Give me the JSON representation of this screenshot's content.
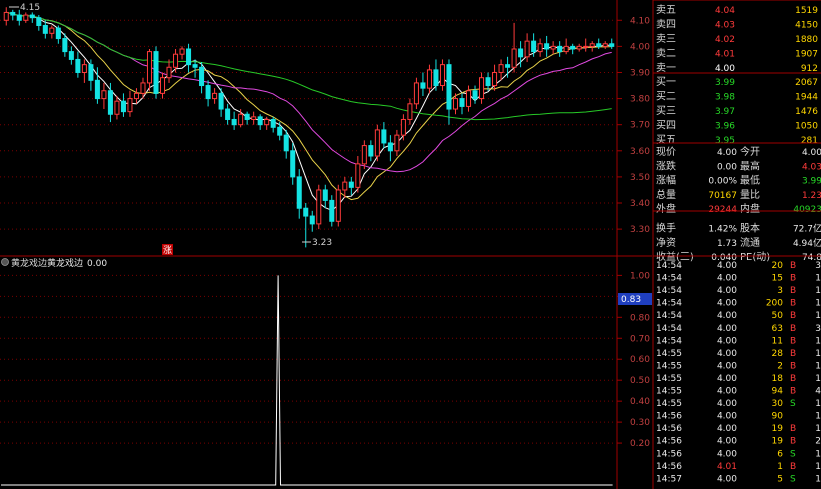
{
  "colors": {
    "up": "#ff3b3b",
    "down": "#14e3e3",
    "ma5": "#ffffff",
    "ma10": "#e8d24a",
    "ma20": "#e04ae0",
    "ma60": "#27c927",
    "grid": "#7a0000",
    "border": "#a00000",
    "highlight": "#1f3fbf",
    "sell_red": "#ff3b3b",
    "buy_green": "#27d827",
    "panel_label": "#d8d8d8",
    "yellow": "#ffd700"
  },
  "main_chart": {
    "max_label": "4.15",
    "min_label": "3.23",
    "y_ticks": [
      "4.10",
      "4.00",
      "3.90",
      "3.80",
      "3.70",
      "3.60",
      "3.50",
      "3.40",
      "3.30"
    ],
    "marker": "涨"
  },
  "chart_data": {
    "type": "candlestick",
    "y_range": [
      3.22,
      4.17
    ],
    "candles": [
      [
        4.1,
        4.13,
        4.08,
        4.15
      ],
      [
        4.13,
        4.12,
        4.1,
        4.14
      ],
      [
        4.12,
        4.1,
        4.08,
        4.14
      ],
      [
        4.1,
        4.12,
        4.09,
        4.13
      ],
      [
        4.12,
        4.11,
        4.09,
        4.13
      ],
      [
        4.11,
        4.08,
        4.06,
        4.12
      ],
      [
        4.08,
        4.05,
        4.03,
        4.1
      ],
      [
        4.05,
        4.07,
        4.03,
        4.08
      ],
      [
        4.07,
        4.03,
        4.01,
        4.08
      ],
      [
        4.03,
        3.98,
        3.96,
        4.05
      ],
      [
        3.98,
        3.95,
        3.93,
        4.0
      ],
      [
        3.95,
        3.9,
        3.88,
        3.98
      ],
      [
        3.9,
        3.93,
        3.86,
        3.95
      ],
      [
        3.93,
        3.87,
        3.83,
        3.95
      ],
      [
        3.87,
        3.8,
        3.78,
        3.92
      ],
      [
        3.8,
        3.83,
        3.76,
        3.86
      ],
      [
        3.83,
        3.74,
        3.71,
        3.86
      ],
      [
        3.74,
        3.79,
        3.72,
        3.81
      ],
      [
        3.79,
        3.75,
        3.73,
        3.82
      ],
      [
        3.75,
        3.8,
        3.73,
        3.83
      ],
      [
        3.8,
        3.82,
        3.78,
        3.84
      ],
      [
        3.82,
        3.86,
        3.8,
        3.88
      ],
      [
        3.86,
        3.98,
        3.83,
        3.99
      ],
      [
        3.98,
        3.82,
        3.8,
        4.0
      ],
      [
        3.82,
        3.88,
        3.8,
        3.9
      ],
      [
        3.88,
        3.92,
        3.86,
        3.95
      ],
      [
        3.92,
        3.97,
        3.9,
        3.99
      ],
      [
        3.97,
        3.99,
        3.95,
        4.0
      ],
      [
        3.99,
        3.93,
        3.9,
        4.01
      ],
      [
        3.93,
        3.92,
        3.88,
        3.95
      ],
      [
        3.92,
        3.85,
        3.82,
        3.94
      ],
      [
        3.85,
        3.8,
        3.77,
        3.87
      ],
      [
        3.8,
        3.82,
        3.78,
        3.84
      ],
      [
        3.82,
        3.76,
        3.73,
        3.84
      ],
      [
        3.76,
        3.72,
        3.7,
        3.78
      ],
      [
        3.72,
        3.7,
        3.68,
        3.75
      ],
      [
        3.7,
        3.74,
        3.69,
        3.76
      ],
      [
        3.74,
        3.72,
        3.7,
        3.75
      ],
      [
        3.72,
        3.73,
        3.7,
        3.75
      ],
      [
        3.73,
        3.7,
        3.68,
        3.74
      ],
      [
        3.7,
        3.72,
        3.68,
        3.73
      ],
      [
        3.72,
        3.69,
        3.67,
        3.73
      ],
      [
        3.69,
        3.66,
        3.64,
        3.71
      ],
      [
        3.66,
        3.6,
        3.57,
        3.68
      ],
      [
        3.6,
        3.5,
        3.47,
        3.63
      ],
      [
        3.5,
        3.38,
        3.34,
        3.53
      ],
      [
        3.38,
        3.35,
        3.23,
        3.4
      ],
      [
        3.35,
        3.32,
        3.29,
        3.37
      ],
      [
        3.32,
        3.45,
        3.3,
        3.47
      ],
      [
        3.45,
        3.41,
        3.38,
        3.47
      ],
      [
        3.41,
        3.33,
        3.31,
        3.43
      ],
      [
        3.33,
        3.45,
        3.31,
        3.47
      ],
      [
        3.45,
        3.48,
        3.42,
        3.5
      ],
      [
        3.48,
        3.46,
        3.43,
        3.5
      ],
      [
        3.46,
        3.55,
        3.44,
        3.58
      ],
      [
        3.55,
        3.62,
        3.53,
        3.64
      ],
      [
        3.62,
        3.58,
        3.56,
        3.64
      ],
      [
        3.58,
        3.68,
        3.56,
        3.7
      ],
      [
        3.68,
        3.63,
        3.61,
        3.71
      ],
      [
        3.63,
        3.6,
        3.56,
        3.66
      ],
      [
        3.6,
        3.66,
        3.58,
        3.68
      ],
      [
        3.66,
        3.72,
        3.64,
        3.74
      ],
      [
        3.72,
        3.78,
        3.7,
        3.8
      ],
      [
        3.78,
        3.86,
        3.76,
        3.88
      ],
      [
        3.86,
        3.84,
        3.81,
        3.9
      ],
      [
        3.84,
        3.91,
        3.82,
        3.93
      ],
      [
        3.91,
        3.85,
        3.83,
        3.95
      ],
      [
        3.85,
        3.93,
        3.83,
        3.95
      ],
      [
        3.93,
        3.76,
        3.7,
        3.95
      ],
      [
        3.76,
        3.8,
        3.74,
        3.82
      ],
      [
        3.8,
        3.77,
        3.74,
        3.82
      ],
      [
        3.77,
        3.83,
        3.75,
        3.85
      ],
      [
        3.83,
        3.8,
        3.78,
        3.85
      ],
      [
        3.8,
        3.88,
        3.78,
        3.9
      ],
      [
        3.88,
        3.85,
        3.83,
        3.9
      ],
      [
        3.85,
        3.9,
        3.83,
        3.93
      ],
      [
        3.9,
        3.93,
        3.87,
        3.95
      ],
      [
        3.93,
        3.92,
        3.88,
        3.96
      ],
      [
        3.92,
        3.99,
        3.9,
        4.09
      ],
      [
        3.99,
        3.96,
        3.92,
        4.02
      ],
      [
        3.96,
        4.02,
        3.94,
        4.05
      ],
      [
        4.02,
        3.98,
        3.96,
        4.05
      ],
      [
        3.98,
        4.01,
        3.96,
        4.03
      ],
      [
        4.01,
        3.99,
        3.96,
        4.04
      ],
      [
        3.99,
        4.0,
        3.97,
        4.02
      ],
      [
        4.0,
        3.98,
        3.96,
        4.02
      ],
      [
        3.98,
        4.0,
        3.97,
        4.03
      ],
      [
        4.0,
        3.99,
        3.97,
        4.01
      ],
      [
        3.99,
        4.0,
        3.98,
        4.01
      ],
      [
        4.0,
        4.0,
        3.98,
        4.03
      ],
      [
        4.0,
        4.01,
        3.98,
        4.02
      ],
      [
        4.01,
        4.0,
        3.99,
        4.03
      ],
      [
        4.0,
        4.01,
        3.99,
        4.02
      ],
      [
        4.01,
        4.0,
        3.99,
        4.03
      ]
    ]
  },
  "indicator": {
    "name": "黄龙戏边",
    "line_name": "黄龙戏边",
    "value": "0.00",
    "y_ticks": [
      "1.00",
      "0.90",
      "0.80",
      "0.70",
      "0.60",
      "0.50",
      "0.40",
      "0.30",
      "0.20"
    ],
    "current_marker": "0.83",
    "values": [
      0,
      0,
      0,
      0,
      0,
      0,
      0,
      0,
      0,
      0,
      0,
      0,
      0,
      0,
      0,
      0,
      0,
      0,
      0,
      0,
      0,
      0,
      0,
      0,
      0,
      0,
      0,
      0,
      0,
      0,
      0,
      0,
      0,
      0,
      0,
      0,
      0,
      0,
      0,
      0,
      0,
      0,
      0,
      0,
      0,
      0,
      0,
      0,
      0,
      0,
      0,
      0,
      0,
      0,
      0,
      0,
      0,
      0,
      0,
      0,
      0,
      0,
      0,
      0,
      0,
      0,
      0,
      0,
      0,
      0,
      0,
      0,
      0,
      0,
      0,
      0,
      0,
      0,
      0,
      0,
      0,
      0,
      0,
      0,
      0,
      0,
      0,
      0,
      0,
      0,
      0,
      0,
      0,
      0,
      0,
      0,
      0,
      0,
      0,
      0,
      0,
      0,
      0,
      0,
      0,
      0,
      0,
      0,
      0,
      0,
      0,
      0,
      0,
      0,
      0,
      0,
      1,
      0,
      0,
      0,
      0,
      0,
      0,
      0,
      0,
      0,
      0,
      0,
      0,
      0,
      0,
      0,
      0,
      0,
      0,
      0,
      0,
      0,
      0,
      0,
      0,
      0,
      0,
      0,
      0,
      0,
      0,
      0,
      0,
      0,
      0,
      0,
      0,
      0,
      0,
      0,
      0,
      0,
      0,
      0,
      0,
      0,
      0,
      0,
      0,
      0,
      0,
      0,
      0,
      0,
      0,
      0,
      0,
      0,
      0,
      0,
      0,
      0,
      0,
      0,
      0,
      0,
      0,
      0,
      0,
      0,
      0,
      0,
      0,
      0,
      0,
      0,
      0,
      0,
      0,
      0,
      0,
      0,
      0,
      0,
      0,
      0,
      0,
      0,
      0,
      0,
      0,
      0,
      0,
      0,
      0,
      0,
      0,
      0,
      0,
      0,
      0,
      0,
      0,
      0,
      0,
      0,
      0,
      0,
      0,
      0,
      0,
      0,
      0,
      0,
      0,
      0,
      0,
      0,
      0,
      0,
      0,
      0,
      0,
      0,
      0,
      0,
      0,
      0,
      0,
      0,
      0,
      0,
      0,
      0,
      0,
      0,
      0,
      0,
      0,
      0,
      0
    ]
  },
  "order_book": {
    "sells": [
      {
        "label": "卖五",
        "price": "4.04",
        "vol": "1519"
      },
      {
        "label": "卖四",
        "price": "4.03",
        "vol": "4150"
      },
      {
        "label": "卖三",
        "price": "4.02",
        "vol": "1880"
      },
      {
        "label": "卖二",
        "price": "4.01",
        "vol": "1907"
      },
      {
        "label": "卖一",
        "price": "4.00",
        "vol": "912"
      }
    ],
    "buys": [
      {
        "label": "买一",
        "price": "3.99",
        "vol": "2067"
      },
      {
        "label": "买二",
        "price": "3.98",
        "vol": "1944"
      },
      {
        "label": "买三",
        "price": "3.97",
        "vol": "1476"
      },
      {
        "label": "买四",
        "price": "3.96",
        "vol": "1050"
      },
      {
        "label": "买五",
        "price": "3.95",
        "vol": "281"
      }
    ]
  },
  "quote": {
    "row1": {
      "k1": "现价",
      "v1": "4.00",
      "k2": "今开",
      "v2": "4.00"
    },
    "row2": {
      "k1": "涨跌",
      "v1": "0.00",
      "k2": "最高",
      "v2": "4.03"
    },
    "row3": {
      "k1": "涨幅",
      "v1": "0.00%",
      "k2": "最低",
      "v2": "3.99"
    },
    "row4": {
      "k1": "总量",
      "v1": "70167",
      "k2": "量比",
      "v2": "1.23"
    },
    "row5": {
      "k1": "外盘",
      "v1": "29244",
      "k2": "内盘",
      "v2": "40923"
    },
    "row6": {
      "k1": "换手",
      "v1": "1.42%",
      "k2": "股本",
      "v2": "72.7亿"
    },
    "row7": {
      "k1": "净资",
      "v1": "1.73",
      "k2": "流通",
      "v2": "4.94亿"
    },
    "row8": {
      "k1": "收益(三)",
      "v1": "0.040",
      "k2": "PE(动)",
      "v2": "74.8"
    }
  },
  "trades": [
    {
      "time": "14:54",
      "price": "4.00",
      "vol": "20",
      "bs": "B",
      "n": "3"
    },
    {
      "time": "14:54",
      "price": "4.00",
      "vol": "15",
      "bs": "B",
      "n": "1"
    },
    {
      "time": "14:54",
      "price": "4.00",
      "vol": "3",
      "bs": "B",
      "n": "1"
    },
    {
      "time": "14:54",
      "price": "4.00",
      "vol": "200",
      "bs": "B",
      "n": "1"
    },
    {
      "time": "14:54",
      "price": "4.00",
      "vol": "50",
      "bs": "B",
      "n": "1"
    },
    {
      "time": "14:54",
      "price": "4.00",
      "vol": "63",
      "bs": "B",
      "n": "3"
    },
    {
      "time": "14:54",
      "price": "4.00",
      "vol": "11",
      "bs": "B",
      "n": "1"
    },
    {
      "time": "14:55",
      "price": "4.00",
      "vol": "28",
      "bs": "B",
      "n": "1"
    },
    {
      "time": "14:55",
      "price": "4.00",
      "vol": "2",
      "bs": "B",
      "n": "1"
    },
    {
      "time": "14:55",
      "price": "4.00",
      "vol": "18",
      "bs": "B",
      "n": "1"
    },
    {
      "time": "14:55",
      "price": "4.00",
      "vol": "94",
      "bs": "B",
      "n": "4"
    },
    {
      "time": "14:55",
      "price": "4.00",
      "vol": "30",
      "bs": "S",
      "n": "1"
    },
    {
      "time": "14:56",
      "price": "4.00",
      "vol": "90",
      "bs": "",
      "n": "1"
    },
    {
      "time": "14:56",
      "price": "4.00",
      "vol": "19",
      "bs": "B",
      "n": "1"
    },
    {
      "time": "14:56",
      "price": "4.00",
      "vol": "19",
      "bs": "B",
      "n": "2"
    },
    {
      "time": "14:56",
      "price": "4.00",
      "vol": "6",
      "bs": "S",
      "n": "1"
    },
    {
      "time": "14:56",
      "price": "4.01",
      "vol": "1",
      "bs": "B",
      "n": "1"
    },
    {
      "time": "14:57",
      "price": "4.00",
      "vol": "5",
      "bs": "S",
      "n": "1"
    }
  ]
}
